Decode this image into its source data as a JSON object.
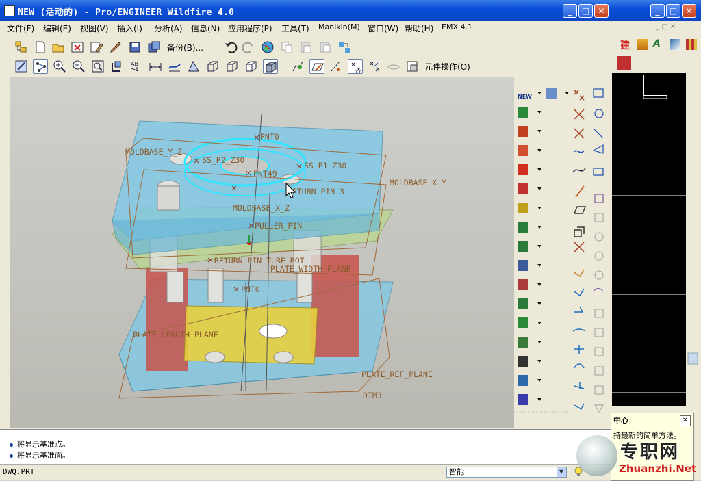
{
  "window": {
    "title": "NEW (活动的) - Pro/ENGINEER Wildfire 4.0",
    "controls": {
      "minimize": "_",
      "maximize": "□",
      "close": "✕"
    }
  },
  "menus": [
    {
      "label": "文件(F)"
    },
    {
      "label": "编辑(E)"
    },
    {
      "label": "视图(V)"
    },
    {
      "label": "插入(I)"
    },
    {
      "label": "分析(A)"
    },
    {
      "label": "信息(N)"
    },
    {
      "label": "应用程序(P)"
    },
    {
      "label": "工具(T)"
    },
    {
      "label": "Manikin(M)"
    },
    {
      "label": "窗口(W)"
    },
    {
      "label": "帮助(H)"
    },
    {
      "label": "EMX 4.1"
    }
  ],
  "toolbar": {
    "backup_label": "备份(B)...",
    "component_ops_label": "元件操作(O)"
  },
  "model_labels": {
    "moldbase_x_z_top": "MOLDBASE_Y_Z",
    "pnt0": "PNT0",
    "ss_p2": "SS_P2_Z30",
    "ss_p1": "SS_P1_Z30",
    "pnt49": "PNT49",
    "return_pin_3": "RETURN_PIN_3",
    "moldbase_x_y": "MOLDBASE_X_Y",
    "moldbase_x_z": "MOLDBASE_X_Z",
    "puller_pin": "PULLER_PIN",
    "return_pin_tube": "RETURN_PIN_TUBE_BOT",
    "plate_width_plane": "PLATE_WIDTH_PLANE",
    "pnt_lower": "PNT0",
    "plate_length_plane": "PLATE_LENGTH_PLANE",
    "plate_ref_plane": "PLATE_REF_PLANE",
    "dtm3": "DTM3"
  },
  "messages": [
    {
      "text": "将显示基准点。"
    },
    {
      "text": "将显示基准面。"
    }
  ],
  "status": {
    "filename": "DWQ.PRT",
    "filter_value": "智能"
  },
  "help_panel": {
    "title": "中心",
    "text": "持最新的简单方法。",
    "close": "✕"
  },
  "watermark": {
    "chinese": "专职网",
    "url": "Zhuanzhi.Net"
  },
  "colors": {
    "titlebar": "#0a4fd8",
    "plate_blue": "#7ec9e8",
    "plate_green": "#b8d98c",
    "block_red": "#c8524a",
    "block_yellow": "#e8d040",
    "datum_label": "#8a5a2a",
    "selection_cyan": "#2ee6ff"
  }
}
